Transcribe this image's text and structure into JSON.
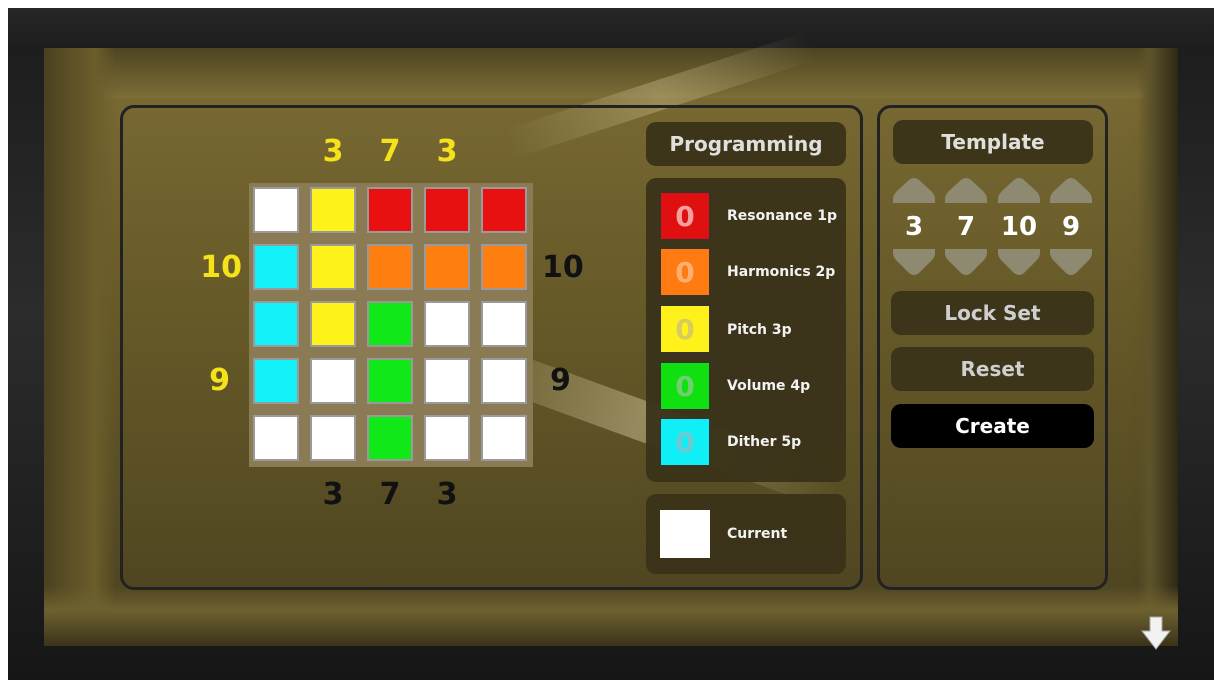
{
  "board": {
    "rows": [
      [
        "white",
        "yellow",
        "red",
        "red",
        "red"
      ],
      [
        "cyan",
        "yellow",
        "orange",
        "orange",
        "orange"
      ],
      [
        "cyan",
        "yellow",
        "green",
        "white",
        "white"
      ],
      [
        "cyan",
        "white",
        "green",
        "white",
        "white"
      ],
      [
        "white",
        "white",
        "green",
        "white",
        "white"
      ]
    ]
  },
  "clues": {
    "top": [
      "3",
      "7",
      "3"
    ],
    "bottom": [
      "3",
      "7",
      "3"
    ],
    "left": {
      "row2": "10",
      "row4": "9"
    },
    "right": {
      "row2": "10",
      "row4": "9"
    }
  },
  "programming": {
    "title": "Programming",
    "items": [
      {
        "label": "Resonance 1p",
        "value": "0",
        "color": "#e01010",
        "text_color": "#f4a0a0"
      },
      {
        "label": "Harmonics 2p",
        "value": "0",
        "color": "#ff7a10",
        "text_color": "#ffb070"
      },
      {
        "label": "Pitch 3p",
        "value": "0",
        "color": "#fff21a",
        "text_color": "#d8cc60"
      },
      {
        "label": "Volume 4p",
        "value": "0",
        "color": "#10e010",
        "text_color": "#70d070"
      },
      {
        "label": "Dither 5p",
        "value": "0",
        "color": "#10eef6",
        "text_color": "#70c8d0"
      }
    ],
    "current_label": "Current",
    "current_color": "#ffffff"
  },
  "template": {
    "title": "Template",
    "values": [
      "3",
      "7",
      "10",
      "9"
    ],
    "lock_set_label": "Lock Set",
    "reset_label": "Reset",
    "create_label": "Create"
  },
  "colors": {
    "white": "#ffffff",
    "yellow": "#fff21a",
    "red": "#e81010",
    "orange": "#ff7e10",
    "green": "#10e818",
    "cyan": "#12f0f8"
  }
}
